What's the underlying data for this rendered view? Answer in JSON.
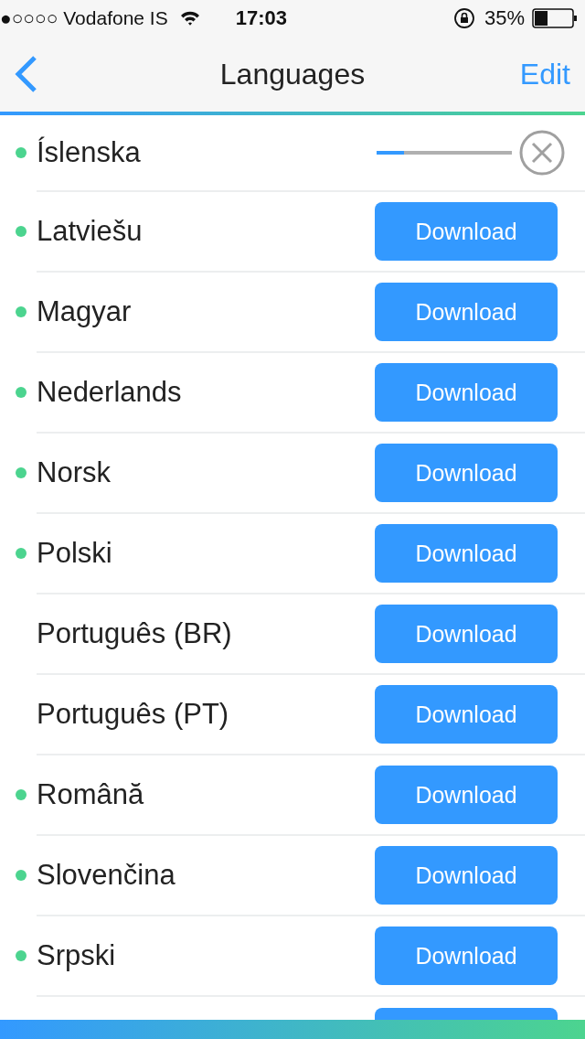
{
  "status_bar": {
    "carrier": "●○○○○ Vodafone IS",
    "time": "17:03",
    "battery": "35%"
  },
  "nav": {
    "title": "Languages",
    "edit": "Edit"
  },
  "languages": [
    {
      "name": "Íslenska",
      "marked": true,
      "kind": "downloading",
      "level": 0.2
    },
    {
      "name": "Latviešu",
      "marked": true,
      "kind": "available",
      "action": "Download"
    },
    {
      "name": "Magyar",
      "marked": true,
      "kind": "available",
      "action": "Download"
    },
    {
      "name": "Nederlands",
      "marked": true,
      "kind": "available",
      "action": "Download"
    },
    {
      "name": "Norsk",
      "marked": true,
      "kind": "available",
      "action": "Download"
    },
    {
      "name": "Polski",
      "marked": true,
      "kind": "available",
      "action": "Download"
    },
    {
      "name": "Português (BR)",
      "marked": false,
      "kind": "available",
      "action": "Download"
    },
    {
      "name": "Português (PT)",
      "marked": false,
      "kind": "available",
      "action": "Download"
    },
    {
      "name": "Română",
      "marked": true,
      "kind": "available",
      "action": "Download"
    },
    {
      "name": "Slovenčina",
      "marked": true,
      "kind": "available",
      "action": "Download"
    },
    {
      "name": "Srpski",
      "marked": true,
      "kind": "available",
      "action": "Download"
    }
  ]
}
